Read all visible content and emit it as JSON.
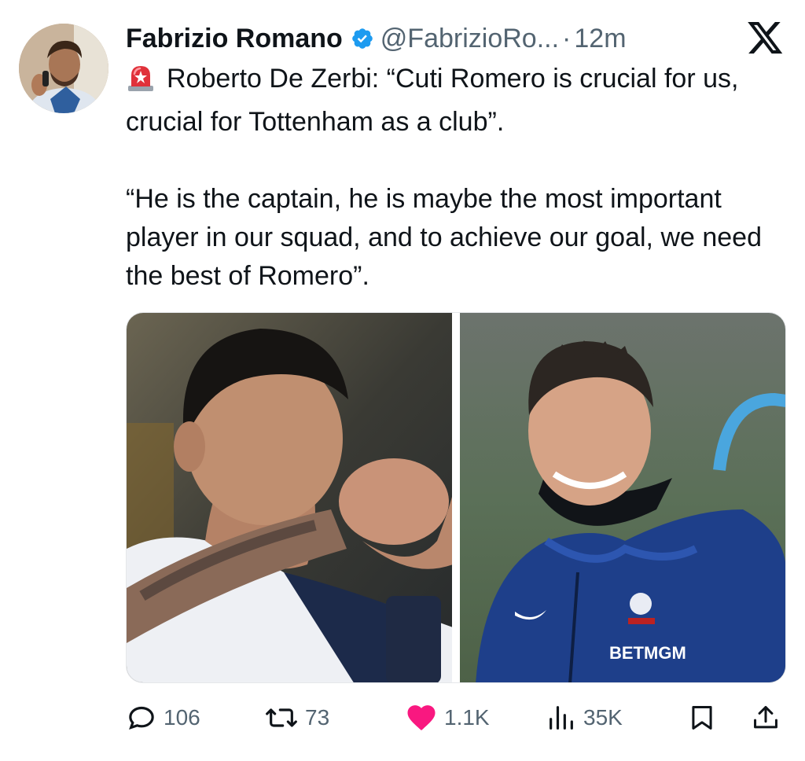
{
  "author": {
    "name": "Fabrizio Romano",
    "handle": "@FabrizioRo...",
    "separator": "·",
    "time": "12m"
  },
  "tweet": {
    "line1": "Roberto De Zerbi: “Cuti Romero is crucial for us, crucial for Tottenham as a club”.",
    "line2": "“He is the captain, he is maybe the most important player in our squad, and to achieve our goal, we need the best of Romero”."
  },
  "media": {
    "left_photo": "player-heart-gesture-photo",
    "right_photo": "manager-smiling-photo",
    "sponsor_text": "BETMGM"
  },
  "actions": {
    "replies": "106",
    "reposts": "73",
    "likes": "1.1K",
    "views": "35K"
  },
  "colors": {
    "text": "#0f1419",
    "muted": "#536471",
    "verified": "#1d9bf0",
    "like": "#f91880"
  },
  "icons": [
    "x-logo-icon",
    "verified-badge-icon",
    "siren-icon",
    "reply-icon",
    "repost-icon",
    "like-icon",
    "views-icon",
    "bookmark-icon",
    "share-icon"
  ]
}
